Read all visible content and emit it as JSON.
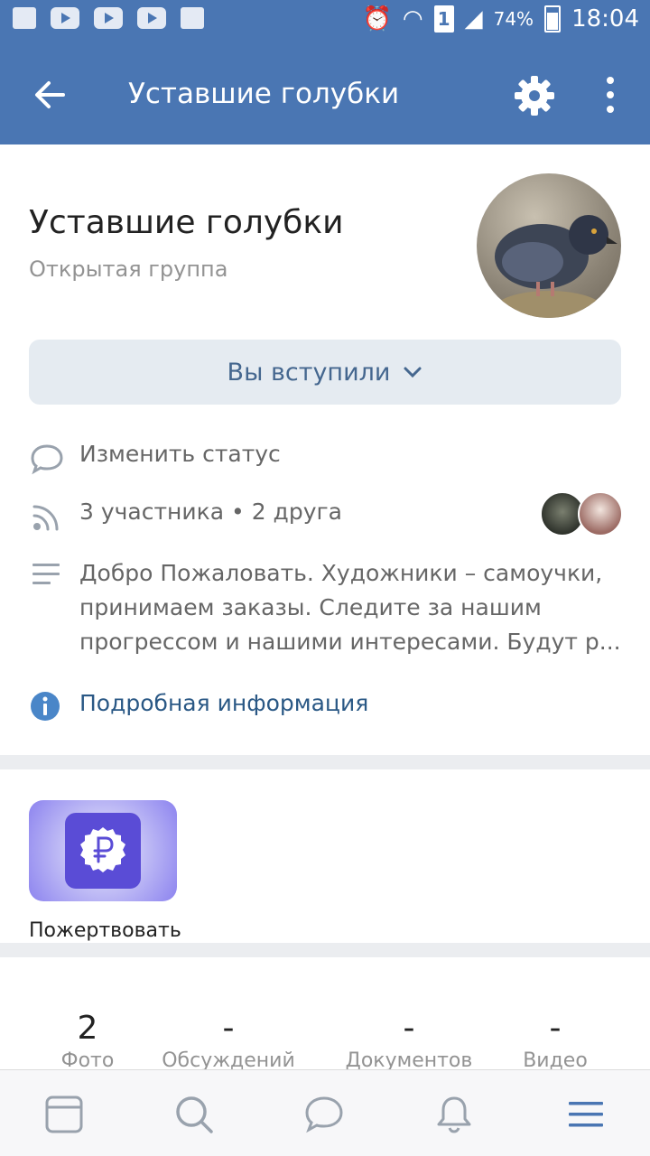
{
  "status_bar": {
    "battery": "74%",
    "time": "18:04",
    "sim": "1"
  },
  "app_bar": {
    "title": "Уставшие голубки"
  },
  "group": {
    "name": "Уставшие голубки",
    "type": "Открытая группа",
    "joined_button": "Вы вступили",
    "change_status": "Изменить статус",
    "members": "3 участника • 2 друга",
    "description": "Добро Пожаловать.  Художники – самоучки,\nпринимаем заказы. Следите за нашим\nпрогрессом и нашими интересами. Будут р...",
    "info_link": "Подробная информация"
  },
  "donate": {
    "label": "Пожертвовать"
  },
  "counters": [
    {
      "num": "2",
      "label": "Фото"
    },
    {
      "num": "-",
      "label": "Обсуждений"
    },
    {
      "num": "-",
      "label": "Документов"
    },
    {
      "num": "-",
      "label": "Видео"
    }
  ],
  "colors": {
    "accent": "#4a76b3",
    "link": "#2a5885",
    "donate": "#5a4cd6"
  },
  "bottom_nav": [
    "news-icon",
    "search-icon",
    "messages-icon",
    "notifications-icon",
    "menu-icon"
  ]
}
